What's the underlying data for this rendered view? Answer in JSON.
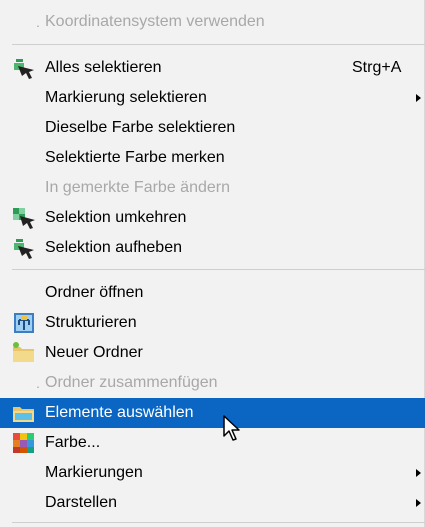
{
  "menu": {
    "items": {
      "koordinaten": {
        "label": "Koordinatensystem verwenden"
      },
      "alles": {
        "label": "Alles selektieren",
        "shortcut": "Strg+A"
      },
      "markierung_sel": {
        "label": "Markierung selektieren"
      },
      "dieselbe_farbe": {
        "label": "Dieselbe Farbe selektieren"
      },
      "farbe_merken": {
        "label": "Selektierte Farbe merken"
      },
      "gemerkte_farbe": {
        "label": "In gemerkte Farbe ändern"
      },
      "umkehren": {
        "label": "Selektion umkehren"
      },
      "aufheben": {
        "label": "Selektion aufheben"
      },
      "ordner_oeffnen": {
        "label": "Ordner öffnen"
      },
      "strukturieren": {
        "label": "Strukturieren"
      },
      "neuer_ordner": {
        "label": "Neuer Ordner"
      },
      "zusammenfuegen": {
        "label": "Ordner zusammenfügen"
      },
      "elemente": {
        "label": "Elemente auswählen"
      },
      "farbe": {
        "label": "Farbe..."
      },
      "markierungen": {
        "label": "Markierungen"
      },
      "darstellen": {
        "label": "Darstellen"
      }
    },
    "colors": {
      "background": "#f2f2f2",
      "selected": "#0a66c2",
      "disabled_text": "#a8a8a8"
    },
    "icons": {
      "alles": "select-all-icon",
      "umkehren": "invert-selection-icon",
      "aufheben": "clear-selection-icon",
      "strukturieren": "structure-icon",
      "neuer_ordner": "new-folder-icon",
      "elemente": "select-elements-folder-icon",
      "farbe": "color-palette-icon",
      "cursor": "mouse-pointer-icon"
    }
  }
}
